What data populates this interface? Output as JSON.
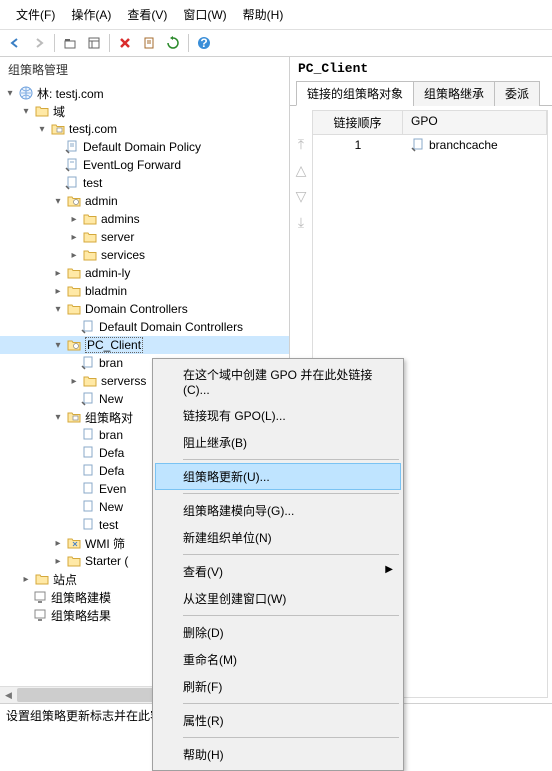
{
  "menubar": {
    "file": "文件(F)",
    "action": "操作(A)",
    "view": "查看(V)",
    "window": "窗口(W)",
    "help": "帮助(H)"
  },
  "left_title": "组策略管理",
  "tree": {
    "forest": "林: testj.com",
    "domains": "域",
    "domain": "testj.com",
    "default_domain_policy": "Default Domain Policy",
    "eventlog_forward": "EventLog Forward",
    "test": "test",
    "admin": "admin",
    "admins": "admins",
    "server": "server",
    "services": "services",
    "admin_ly": "admin-ly",
    "bladmin": "bladmin",
    "domain_controllers": "Domain Controllers",
    "default_dc": "Default Domain Controllers",
    "pc_client": "PC_Client",
    "bran": "bran",
    "serverss": "serverss",
    "new1": "New",
    "gpo_target": "组策略对",
    "bran2": "bran",
    "defa1": "Defa",
    "defa2": "Defa",
    "even": "Even",
    "new2": "New",
    "test2": "test",
    "wmi": "WMI 筛",
    "starter": "Starter (",
    "sites": "站点",
    "gpo_modeling": "组策略建模",
    "gpo_results": "组策略结果"
  },
  "right": {
    "title": "PC_Client",
    "tabs": {
      "t1": "链接的组策略对象",
      "t2": "组策略继承",
      "t3": "委派"
    },
    "columns": {
      "c1": "链接顺序",
      "c2": "GPO"
    },
    "row1": {
      "order": "1",
      "gpo": "branchcache"
    }
  },
  "context_menu": {
    "i1": "在这个域中创建 GPO 并在此处链接(C)...",
    "i2": "链接现有 GPO(L)...",
    "i3": "阻止继承(B)",
    "i4": "组策略更新(U)...",
    "i5": "组策略建模向导(G)...",
    "i6": "新建组织单位(N)",
    "i7": "查看(V)",
    "i8": "从这里创建窗口(W)",
    "i9": "删除(D)",
    "i10": "重命名(M)",
    "i11": "刷新(F)",
    "i12": "属性(R)",
    "i13": "帮助(H)"
  },
  "statusbar": "设置组策略更新标志并在此容器上执行 Gpupdate"
}
